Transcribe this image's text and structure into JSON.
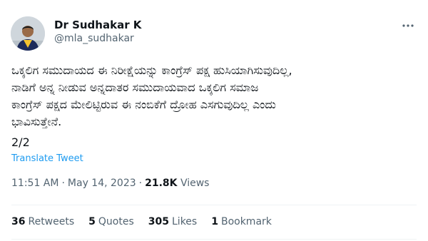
{
  "author": {
    "display_name": "Dr Sudhakar K",
    "handle": "@mla_sudhakar"
  },
  "tweet": {
    "text_lines": [
      "ಒಕ್ಕಲಿಗ ಸಮುದಾಯದ ಈ ನಿರೀಕ್ಷೆಯನ್ನು ಕಾಂಗ್ರೆಸ್ ಪಕ್ಷ ಹುಸಿಯಾಗಿಸುವುದಿಲ್ಲ,",
      "ನಾಡಿಗೆ ಅನ್ನ ನೀಡುವ ಅನ್ನದಾತರ ಸಮುದಾಯವಾದ ಒಕ್ಕಲಿಗ ಸಮಾಜ",
      "ಕಾಂಗ್ರೆಸ್ ಪಕ್ಷದ ಮೇಲಿಟ್ಟಿರುವ ಈ ನಂಬಿಕೆಗೆ ದ್ರೋಹ ಎಸಗುವುದಿಲ್ಲ ಎಂದು",
      "ಭಾವಿಸುತ್ತೇನೆ."
    ],
    "thread_index": "2/2",
    "translate_label": "Translate Tweet"
  },
  "meta": {
    "time": "11:51 AM",
    "date": "May 14, 2023",
    "separator": "·",
    "views_count": "21.8K",
    "views_label": "Views"
  },
  "stats": {
    "retweets_count": "36",
    "retweets_label": "Retweets",
    "quotes_count": "5",
    "quotes_label": "Quotes",
    "likes_count": "305",
    "likes_label": "Likes",
    "bookmarks_count": "1",
    "bookmarks_label": "Bookmark"
  },
  "icons": {
    "more": "more-horizontal-icon",
    "avatar": "profile-photo"
  },
  "colors": {
    "text_primary": "#0f1419",
    "text_secondary": "#536471",
    "link": "#1d9bf0",
    "divider": "#eff3f4"
  }
}
